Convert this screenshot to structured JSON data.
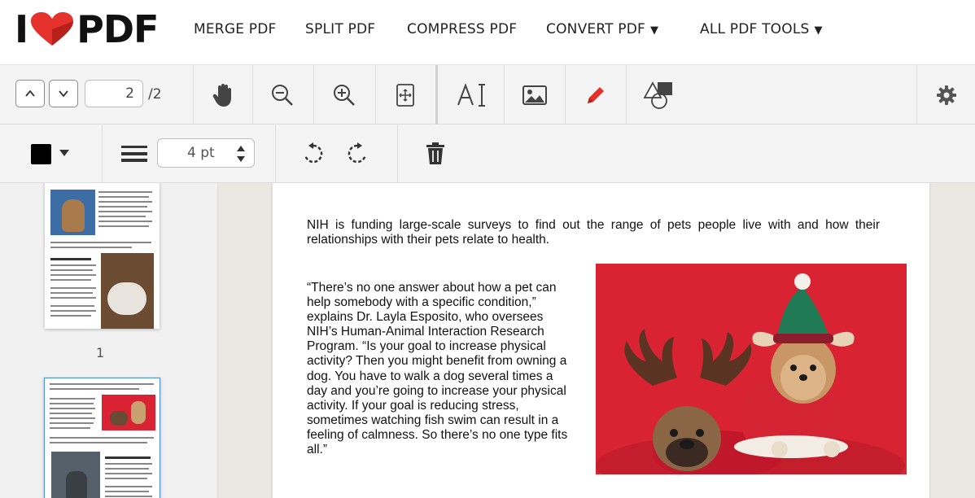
{
  "brand": {
    "logo_left": "I",
    "logo_right": "PDF"
  },
  "nav": {
    "items": [
      {
        "label": "MERGE PDF"
      },
      {
        "label": "SPLIT PDF"
      },
      {
        "label": "COMPRESS PDF"
      },
      {
        "label": "CONVERT PDF"
      },
      {
        "label": "ALL PDF TOOLS"
      }
    ]
  },
  "toolbar": {
    "current_page": "2",
    "total_pages": "/2",
    "stroke_width": "4 pt"
  },
  "sidebar": {
    "thumb1_number": "1"
  },
  "document": {
    "paragraph1": "NIH is funding large-scale surveys to find out the range of pets people live with and how their relationships with their pets relate to health.",
    "paragraph2": "“There’s no one answer about how a pet can help somebody with a  specific condition,” explains Dr. Layla Esposito, who oversees NIH’s Human-Animal  Interaction Research Program. “Is your goal to increase physical activity? Then you might benefit from owning a dog. You have to walk a dog several times a day and you’re going to increase your physical activity.  If your goal is reducing stress, sometimes watching fish swim can result in a feeling of calmness. So there’s no one type fits all.”"
  },
  "colors": {
    "brand_red": "#e5322d",
    "pen_active": "#e5322d",
    "selected_color": "#000000",
    "photo_background": "#d92332"
  }
}
